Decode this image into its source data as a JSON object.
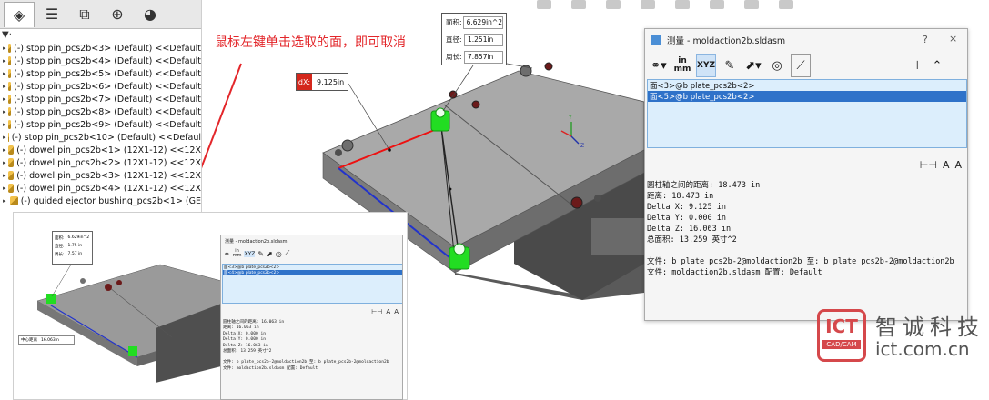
{
  "annotation": "鼠标左键单击选取的面，即可取消",
  "tree": {
    "filter_icon": "filter-icon",
    "tabs": [
      "feature-manager-icon",
      "property-manager-icon",
      "configuration-manager-icon",
      "dim-xpert-icon",
      "display-manager-icon"
    ],
    "items": [
      "(-) stop pin_pcs2b<3> (Default) <<Default",
      "(-) stop pin_pcs2b<4> (Default) <<Default",
      "(-) stop pin_pcs2b<5> (Default) <<Default",
      "(-) stop pin_pcs2b<6> (Default) <<Default",
      "(-) stop pin_pcs2b<7> (Default) <<Default",
      "(-) stop pin_pcs2b<8> (Default) <<Default",
      "(-) stop pin_pcs2b<9> (Default) <<Default",
      "(-) stop pin_pcs2b<10> (Default) <<Defaul",
      "(-) dowel pin_pcs2b<1> (12X1-12) <<12X",
      "(-) dowel pin_pcs2b<2> (12X1-12) <<12X",
      "(-) dowel pin_pcs2b<3> (12X1-12) <<12X",
      "(-) dowel pin_pcs2b<4> (12X1-12) <<12X",
      "(-) guided ejector bushing_pcs2b<1> (GE"
    ]
  },
  "callout_dx": {
    "label": "dX:",
    "value": "9.125in"
  },
  "callout_area": {
    "rows": [
      {
        "k": "面积:",
        "v": "6.629in^2"
      },
      {
        "k": "直径:",
        "v": "1.251in"
      },
      {
        "k": "周长:",
        "v": "7.857in"
      }
    ]
  },
  "measure_dialog": {
    "title": "测量 - moldaction2b.sldasm",
    "help": "?",
    "close": "×",
    "pin_icon": "pin-icon",
    "collapse_icon": "chevron-up-icon",
    "toolbar": {
      "arc_options_icon": "arc-circle-options-icon",
      "units_icon": "units-precision-icon",
      "units_label_top": "in",
      "units_label_bottom": "mm",
      "xyz_icon": "xyz-measure-icon",
      "xyz_label": "XYZ",
      "point_to_point_icon": "point-to-point-icon",
      "projection_icon": "projection-icon",
      "sensor_icon": "create-sensor-icon",
      "history_icon": "measure-history-icon"
    },
    "selections": [
      {
        "text": "面<3>@b plate_pcs2b<2>",
        "selected": false
      },
      {
        "text": "面<5>@b plate_pcs2b<2>",
        "selected": true
      }
    ],
    "format_icons": [
      "dimension-format-icon",
      "increase-font-icon",
      "decrease-font-icon"
    ],
    "results": [
      "圆柱轴之间的距离:  18.473 in",
      "距离: 18.473 in",
      "Delta X: 9.125 in",
      "Delta Y: 0.000 in",
      "Delta Z: 16.063 in",
      "总面积: 13.259 英寸^2"
    ],
    "files": [
      "文件:  b plate_pcs2b-2@moldaction2b 至:  b plate_pcs2b-2@moldaction2b",
      "文件:  moldaction2b.sldasm 配置:  Default"
    ]
  },
  "inset": {
    "dialog_title": "测量 - moldaction2b.sldasm",
    "units_top": "in",
    "units_bottom": "mm",
    "selections": [
      {
        "text": "面<3>@b plate_pcs2b<2>",
        "selected": false
      },
      {
        "text": "面<4>@b plate_pcs2b<2>",
        "selected": true
      }
    ],
    "results": [
      "圆柱轴之间的距离:  16.063 in",
      "距离: 16.063 in",
      "Delta X: 0.000 in",
      "Delta Y: 0.000 in",
      "Delta Z: 16.063 in",
      "总面积: 13.259 英寸^2"
    ],
    "files": [
      "文件:  b plate_pcs2b-2@moldaction2b 至:  b plate_pcs2b-2@moldaction2b",
      "文件:  moldaction2b.sldasm 配置:  Default"
    ],
    "callout_rows": [
      {
        "k": "面积:",
        "v": "6.629in^2"
      },
      {
        "k": "直径:",
        "v": "1.75 in"
      },
      {
        "k": "周长:",
        "v": "7.57 in"
      }
    ],
    "field_label": "中心距离",
    "field_value": "16.063in"
  },
  "watermark": {
    "badge_big": "ICT",
    "badge_small": "CAD/CAM",
    "name": "智诚科技",
    "url": "ict.com.cn"
  },
  "colors": {
    "accent_red": "#e3262a",
    "plate_gray": "#8f8f8f",
    "selection_blue": "#2f72c9",
    "face_green": "#22dd22"
  }
}
